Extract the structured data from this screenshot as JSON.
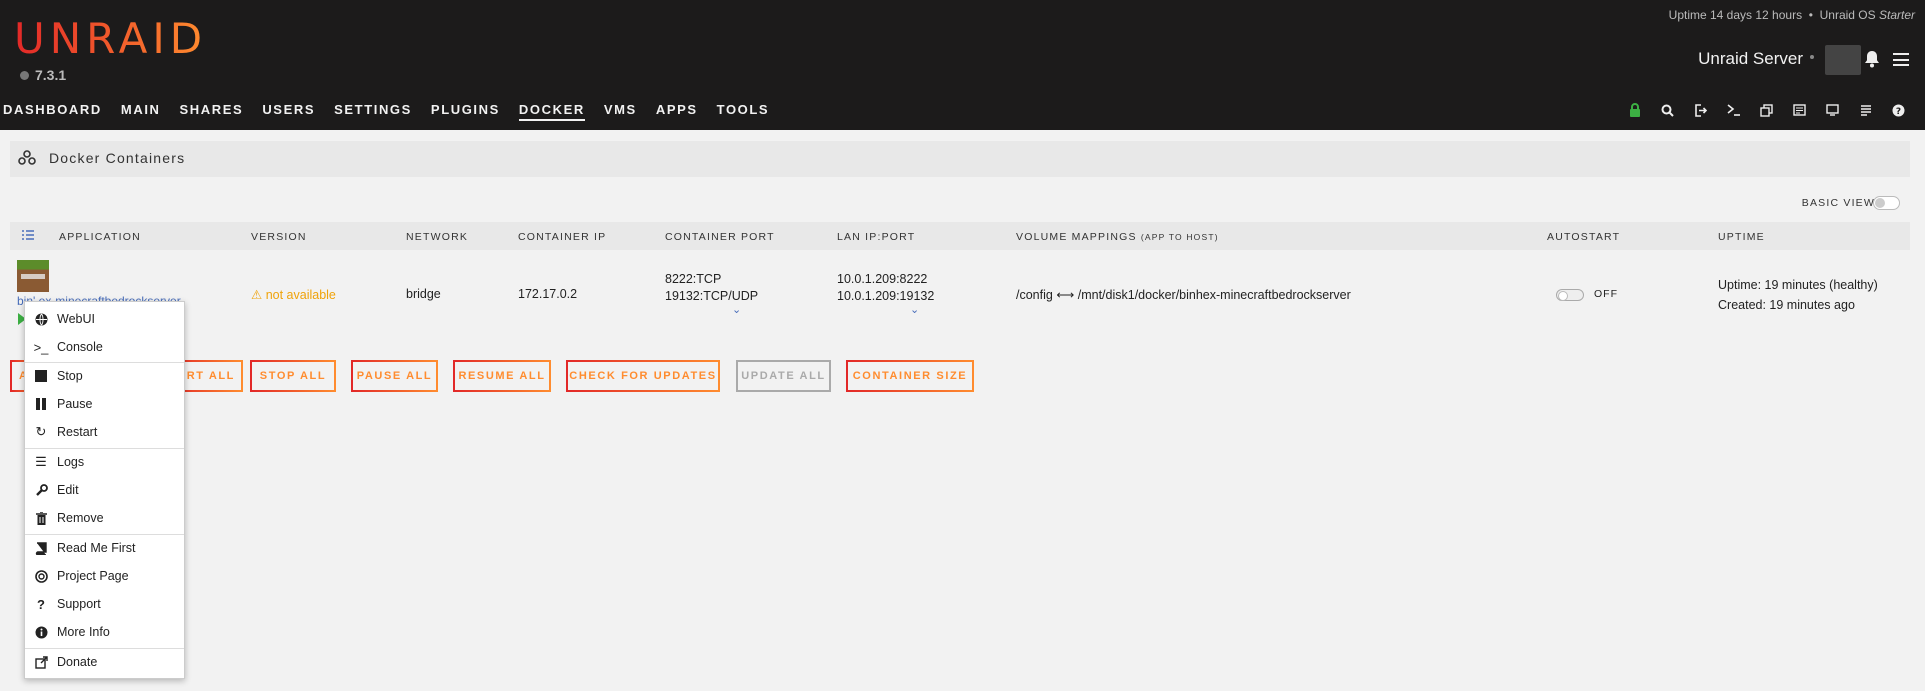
{
  "header": {
    "logo": "UNRAID",
    "version": "7.3.1",
    "uptime": "Uptime 14 days 12 hours",
    "bullet": "•",
    "os_prefix": "Unraid OS",
    "os_edition": "Starter",
    "server_name": "Unraid Server"
  },
  "nav": {
    "items": [
      "DASHBOARD",
      "MAIN",
      "SHARES",
      "USERS",
      "SETTINGS",
      "PLUGINS",
      "DOCKER",
      "VMS",
      "APPS",
      "TOOLS"
    ],
    "active": "DOCKER",
    "icons": [
      "lock-icon",
      "search-icon",
      "logout-icon",
      "terminal-icon",
      "copy-icon",
      "notes-icon",
      "monitor-icon",
      "log-icon",
      "help-icon"
    ]
  },
  "page": {
    "title": "Docker Containers",
    "basic_view": "BASIC VIEW"
  },
  "table": {
    "headers": {
      "application": "APPLICATION",
      "version": "VERSION",
      "network": "NETWORK",
      "container_ip": "CONTAINER IP",
      "container_port": "CONTAINER PORT",
      "lan_ip_port": "LAN IP:PORT",
      "volume_mappings": "VOLUME MAPPINGS",
      "volume_mappings_sub": "(APP TO HOST)",
      "autostart": "AUTOSTART",
      "uptime": "UPTIME"
    },
    "row": {
      "name": "binhex-minecraftbedrockserver",
      "name_visible": "bin' ex-minecraftbedrockserver",
      "version": "not available",
      "network": "bridge",
      "container_ip": "172.17.0.2",
      "ports": [
        "8222:TCP",
        "19132:TCP/UDP"
      ],
      "lan": [
        "10.0.1.209:8222",
        "10.0.1.209:19132"
      ],
      "volume_container": "/config",
      "volume_arrow": "⟷",
      "volume_host": "/mnt/disk1/docker/binhex-minecraftbedrockserver",
      "autostart": "OFF",
      "uptime": "Uptime: 19 minutes (healthy)",
      "created": "Created: 19 minutes ago"
    }
  },
  "buttons": {
    "first_partial": "A",
    "start_all_partial": "RT ALL",
    "stop_all": "STOP ALL",
    "pause_all": "PAUSE ALL",
    "resume_all": "RESUME ALL",
    "check_updates": "CHECK FOR UPDATES",
    "update_all": "UPDATE ALL",
    "container_size": "CONTAINER SIZE"
  },
  "context_menu": {
    "webui": "WebUI",
    "console": "Console",
    "stop": "Stop",
    "pause": "Pause",
    "restart": "Restart",
    "logs": "Logs",
    "edit": "Edit",
    "remove": "Remove",
    "readme": "Read Me First",
    "project": "Project Page",
    "support": "Support",
    "more_info": "More Info",
    "donate": "Donate"
  }
}
